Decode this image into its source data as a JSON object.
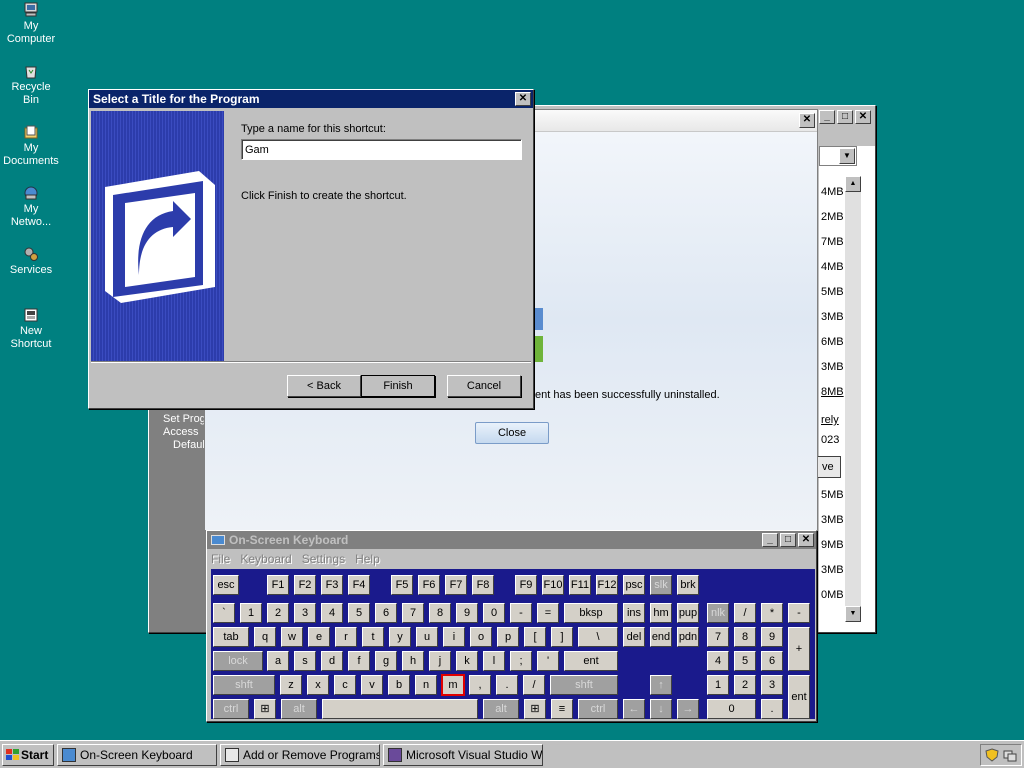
{
  "desktop": {
    "icons": [
      {
        "label": "My\nComputer"
      },
      {
        "label": "Recycle\nBin"
      },
      {
        "label": "My\nDocuments"
      },
      {
        "label": "My\nNetwo..."
      },
      {
        "label": "Services"
      },
      {
        "label": "New\nShortcut"
      }
    ]
  },
  "arp_window": {
    "left_panel_lines": [
      "Set Prog",
      "Access",
      "Defaul"
    ],
    "sizes": [
      "4MB",
      "2MB",
      "7MB",
      "4MB",
      "5MB",
      "3MB",
      "6MB",
      "3MB",
      "8MB"
    ],
    "link_text": "rely",
    "date_text": "023",
    "remove_label": "ve",
    "sizes_lower": [
      "5MB",
      "3MB",
      "9MB",
      "3MB",
      "0MB"
    ]
  },
  "uninstall_dialog": {
    "message": "ent has been successfully uninstalled.",
    "close_label": "Close"
  },
  "wizard": {
    "title": "Select a Title for the Program",
    "prompt": "Type a name for this shortcut:",
    "name_value": "Gam",
    "hint": "Click Finish to create the shortcut.",
    "back_label": "< Back",
    "finish_label": "Finish",
    "cancel_label": "Cancel"
  },
  "osk": {
    "title": "On-Screen Keyboard",
    "menu": [
      "File",
      "Keyboard",
      "Settings",
      "Help"
    ]
  },
  "taskbar": {
    "start_label": "Start",
    "tasks": [
      "On-Screen Keyboard",
      "Add or Remove Programs",
      "Microsoft Visual Studio W..."
    ]
  }
}
